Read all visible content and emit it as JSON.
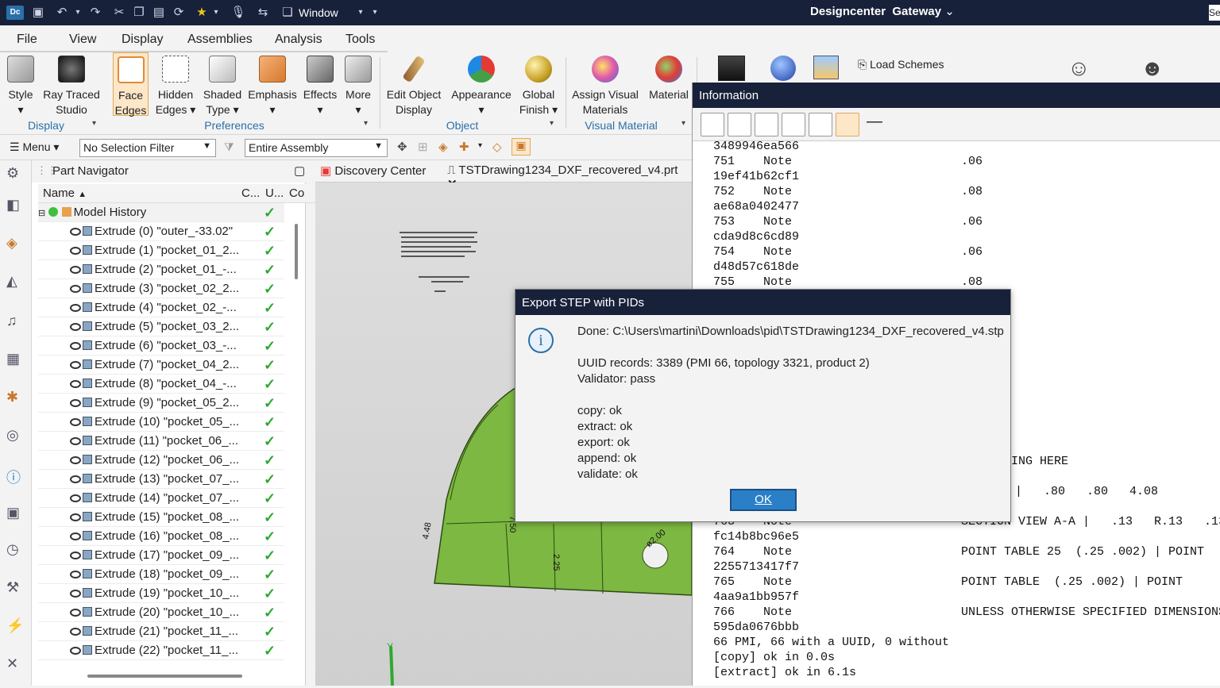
{
  "titlebar": {
    "window_label": "Window",
    "app_title": "Designcenter",
    "gateway_label": "Gateway"
  },
  "menu": {
    "tabs": [
      "File",
      "View",
      "Display",
      "Assemblies",
      "Analysis",
      "Tools"
    ],
    "active_tab": "Display"
  },
  "ribbon": {
    "buttons": [
      {
        "label1": "Style",
        "label2": "▾",
        "icon": "style-icon"
      },
      {
        "label1": "Ray Traced",
        "label2": "Studio",
        "icon": "ray-traced-icon"
      },
      {
        "label1": "Face",
        "label2": "Edges",
        "icon": "face-edges-icon"
      },
      {
        "label1": "Hidden",
        "label2": "Edges ▾",
        "icon": "hidden-edges-icon"
      },
      {
        "label1": "Shaded",
        "label2": "Type ▾",
        "icon": "shaded-type-icon"
      },
      {
        "label1": "Emphasis",
        "label2": "▾",
        "icon": "emphasis-icon"
      },
      {
        "label1": "Effects",
        "label2": "▾",
        "icon": "effects-icon"
      },
      {
        "label1": "More",
        "label2": "▾",
        "icon": "more-icon"
      },
      {
        "label1": "Edit Object",
        "label2": "Display",
        "icon": "edit-object-display-icon"
      },
      {
        "label1": "Appearance",
        "label2": "▾",
        "icon": "appearance-icon"
      },
      {
        "label1": "Global",
        "label2": "Finish ▾",
        "icon": "global-finish-icon"
      },
      {
        "label1": "Assign Visual",
        "label2": "Materials",
        "icon": "assign-visual-materials-icon"
      },
      {
        "label1": "Material",
        "label2": "",
        "icon": "material-icon"
      }
    ],
    "groups": [
      "Display",
      "Preferences",
      "Object",
      "Visual Material"
    ],
    "load_schemes": "Load Schemes"
  },
  "toolbar": {
    "menu_label": "Menu",
    "selection_filter": "No Selection Filter",
    "scope": "Entire Assembly"
  },
  "navigator": {
    "title": "Part Navigator",
    "columns": [
      "Name",
      "C...",
      "U...",
      "Co"
    ],
    "root": "Model History",
    "items": [
      "Extrude (0) \"outer_-33.02\"",
      "Extrude (1) \"pocket_01_2...",
      "Extrude (2) \"pocket_01_-...",
      "Extrude (3) \"pocket_02_2...",
      "Extrude (4) \"pocket_02_-...",
      "Extrude (5) \"pocket_03_2...",
      "Extrude (6) \"pocket_03_-...",
      "Extrude (7) \"pocket_04_2...",
      "Extrude (8) \"pocket_04_-...",
      "Extrude (9) \"pocket_05_2...",
      "Extrude (10) \"pocket_05_...",
      "Extrude (11) \"pocket_06_...",
      "Extrude (12) \"pocket_06_...",
      "Extrude (13) \"pocket_07_...",
      "Extrude (14) \"pocket_07_...",
      "Extrude (15) \"pocket_08_...",
      "Extrude (16) \"pocket_08_...",
      "Extrude (17) \"pocket_09_...",
      "Extrude (18) \"pocket_09_...",
      "Extrude (19) \"pocket_10_...",
      "Extrude (20) \"pocket_10_...",
      "Extrude (21) \"pocket_11_...",
      "Extrude (22) \"pocket_11_..."
    ]
  },
  "doc_tabs": [
    "Discovery Center",
    "TSTDrawing1234_DXF_recovered_v4.prt"
  ],
  "viewport": {
    "dims": [
      "4.48",
      "7.50",
      "2.25",
      "ø2.00"
    ],
    "axis": "Y"
  },
  "info": {
    "title": "Information",
    "lines_top": [
      {
        "a": "3489946ea566",
        "b": ""
      },
      {
        "a": "751    Note",
        "b": ".06"
      },
      {
        "a": "19ef41b62cf1",
        "b": ""
      },
      {
        "a": "752    Note",
        "b": ".08"
      },
      {
        "a": "ae68a0402477",
        "b": ""
      },
      {
        "a": "753    Note",
        "b": ".06"
      },
      {
        "a": "cda9d8c6cd89",
        "b": ""
      },
      {
        "a": "754    Note",
        "b": ".06"
      },
      {
        "a": "d48d57c618de",
        "b": ""
      },
      {
        "a": "755    Note",
        "b": ".08"
      }
    ],
    "right_frag1": "RT MARKING HERE",
    "right_frag2": "W |   .80   .80   4.08",
    "lines_bottom": [
      {
        "a": "763    Note",
        "b": "SECTION VIEW A-A |   .13   R.13   .13"
      },
      {
        "a": "fc14b8bc96e5",
        "b": ""
      },
      {
        "a": "764    Note",
        "b": "POINT TABLE 25  (.25 .002) | POINT"
      },
      {
        "a": "2255713417f7",
        "b": ""
      },
      {
        "a": "765    Note",
        "b": "POINT TABLE  (.25 .002) | POINT"
      },
      {
        "a": "4aa9a1bb957f",
        "b": ""
      },
      {
        "a": "766    Note",
        "b": "UNLESS OTHERWISE SPECIFIED DIMENSIONS"
      },
      {
        "a": "595da0676bbb",
        "b": ""
      },
      {
        "a": "66 PMI, 66 with a UUID, 0 without",
        "b": ""
      },
      {
        "a": "[copy] ok in 0.0s",
        "b": ""
      },
      {
        "a": "[extract] ok in 6.1s",
        "b": ""
      }
    ]
  },
  "dialog": {
    "title": "Export STEP with PIDs",
    "done": "Done: C:\\Users\\martini\\Downloads\\pid\\TSTDrawing1234_DXF_recovered_v4.stp",
    "uuid": "UUID records: 3389 (PMI 66, topology 3321, product 2)",
    "validator": "Validator: pass",
    "steps": [
      "copy: ok",
      "extract: ok",
      "export: ok",
      "append: ok",
      "validate: ok"
    ],
    "ok": "OK"
  },
  "colors": {
    "titlebar": "#18213a",
    "accent": "#2b7fc7",
    "part_green": "#7cb842",
    "check_green": "#2fa82f"
  }
}
